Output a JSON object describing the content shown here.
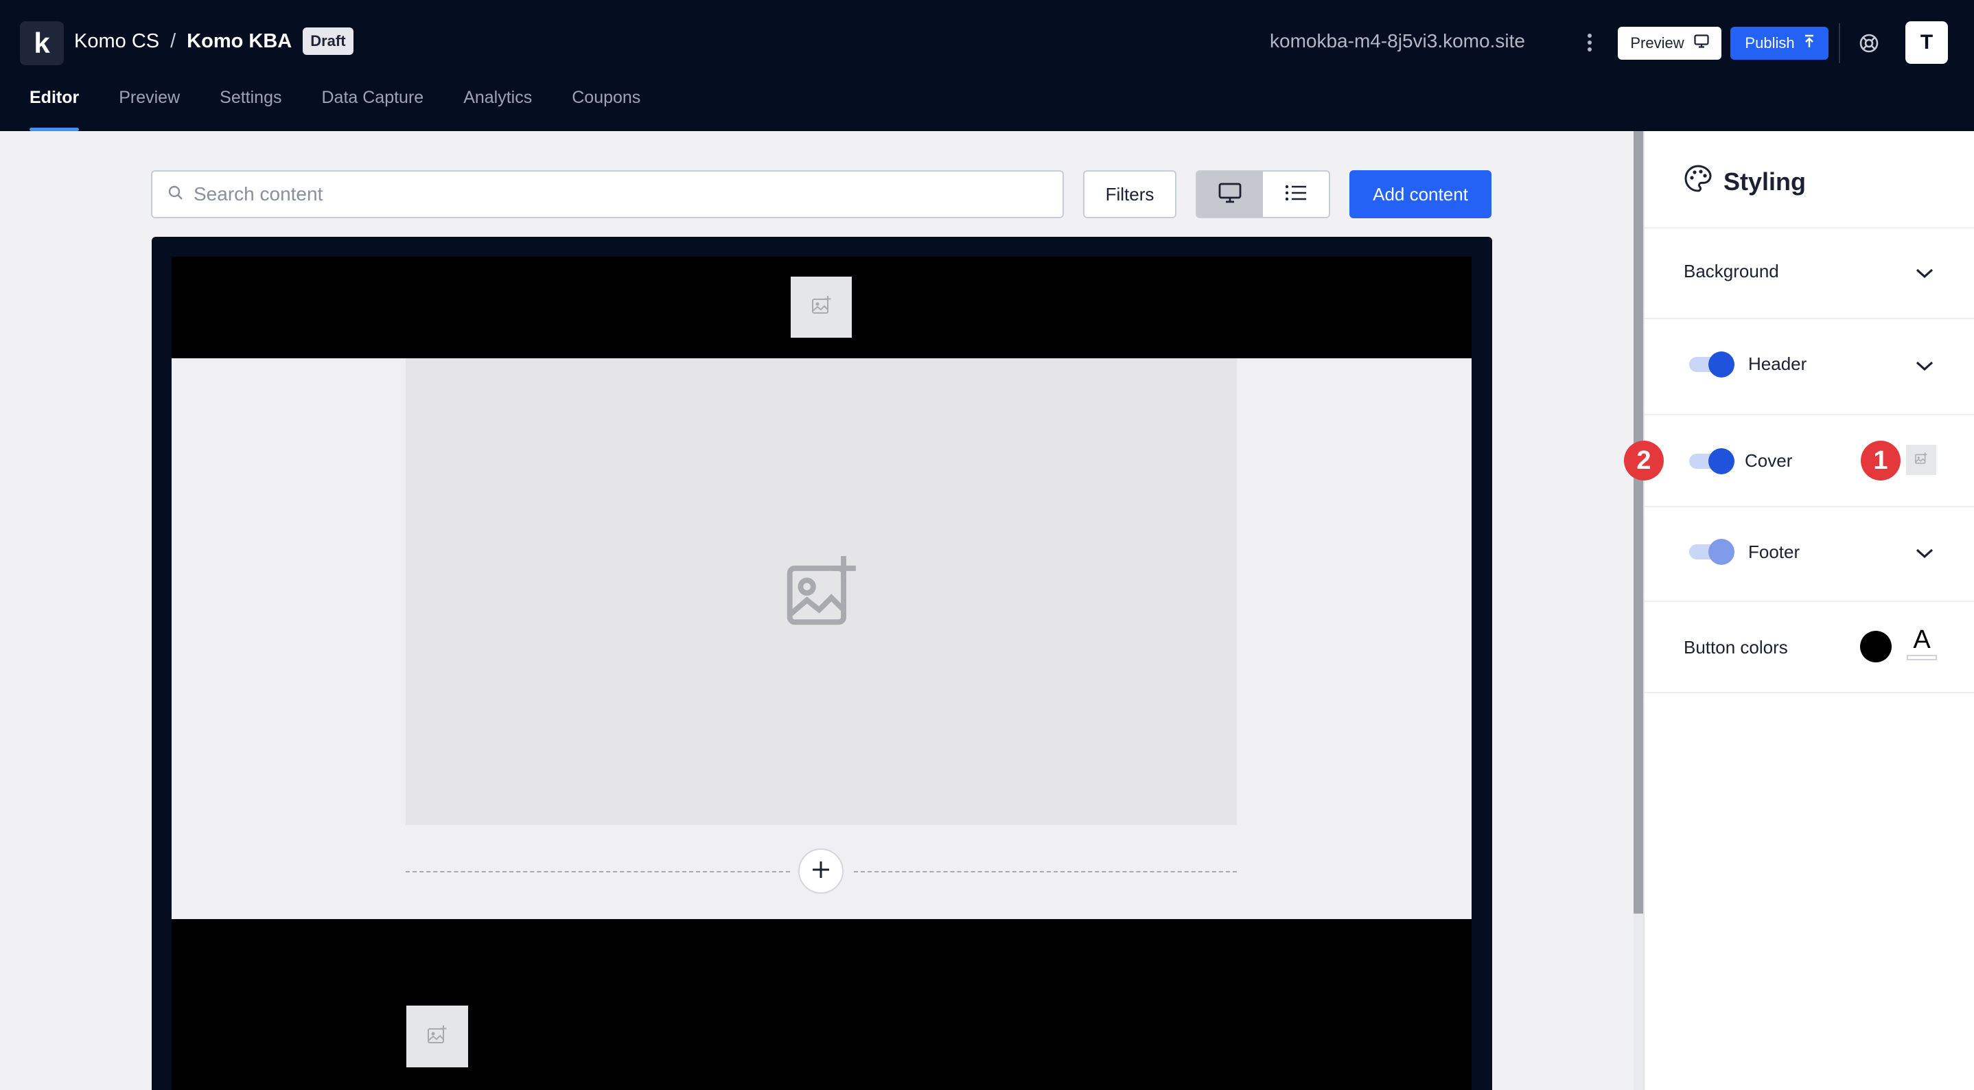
{
  "app": {
    "logo_letter": "k",
    "breadcrumb": {
      "org": "Komo CS",
      "separator": "/",
      "project": "Komo KBA"
    },
    "status_badge": "Draft",
    "domain": "komokba-m4-8j5vi3.komo.site",
    "more_icon": "more-vertical-icon",
    "preview_button": "Preview",
    "publish_button": "Publish",
    "help_icon": "life-buoy-icon",
    "avatar_initial": "T",
    "accent_color": "#2362f4",
    "topbar_color": "#050d21"
  },
  "tabs": [
    {
      "label": "Editor",
      "active": true
    },
    {
      "label": "Preview",
      "active": false
    },
    {
      "label": "Settings",
      "active": false
    },
    {
      "label": "Data Capture",
      "active": false
    },
    {
      "label": "Analytics",
      "active": false
    },
    {
      "label": "Coupons",
      "active": false
    }
  ],
  "toolbar": {
    "search_placeholder": "Search content",
    "search_value": "",
    "filters_button": "Filters",
    "view_modes": [
      "desktop-icon",
      "list-icon"
    ],
    "active_view": "desktop-icon",
    "add_button": "Add content"
  },
  "styling": {
    "title": "Styling",
    "title_icon": "palette-icon",
    "rows": {
      "background": {
        "label": "Background"
      },
      "header": {
        "label": "Header",
        "enabled": true
      },
      "cover": {
        "label": "Cover",
        "enabled": true
      },
      "footer": {
        "label": "Footer",
        "enabled": true
      },
      "button_colors": {
        "label": "Button colors",
        "fill_color": "#000000",
        "text_letter": "A"
      }
    },
    "annotations": {
      "one": "1",
      "two": "2"
    },
    "annotation_color": "#e4383d"
  }
}
